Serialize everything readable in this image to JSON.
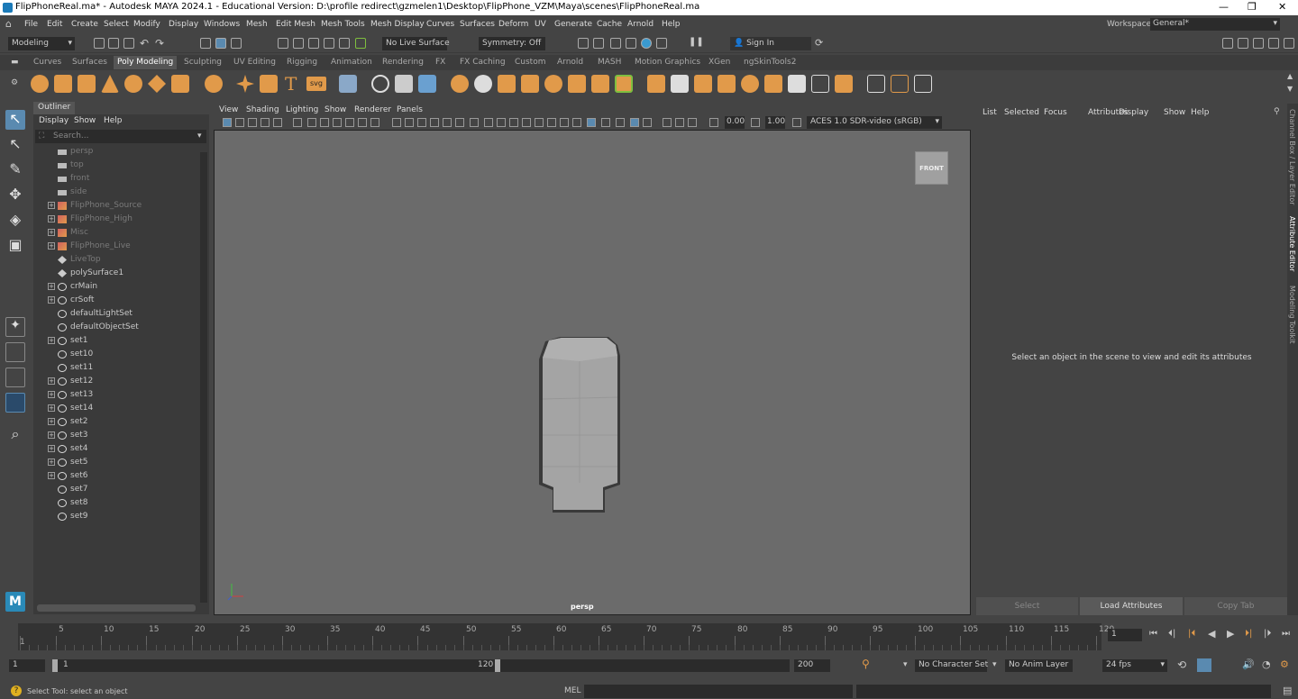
{
  "window": {
    "title": "FlipPhoneReal.ma* - Autodesk MAYA 2024.1 - Educational Version: D:\\profile redirect\\gzmelen1\\Desktop\\FlipPhone_VZM\\Maya\\scenes\\FlipPhoneReal.ma"
  },
  "menu": {
    "items": [
      "File",
      "Edit",
      "Create",
      "Select",
      "Modify",
      "Display",
      "Windows",
      "Mesh",
      "Edit Mesh",
      "Mesh Tools",
      "Mesh Display",
      "Curves",
      "Surfaces",
      "Deform",
      "UV",
      "Generate",
      "Cache",
      "Arnold",
      "Help"
    ],
    "workspace_label": "Workspace:",
    "workspace_value": "General*"
  },
  "status_line": {
    "mode": "Modeling",
    "live_surface": "No Live Surface",
    "symmetry": "Symmetry: Off",
    "sign_in": "Sign In"
  },
  "shelf": {
    "tabs": [
      "Curves",
      "Surfaces",
      "Poly Modeling",
      "Sculpting",
      "UV Editing",
      "Rigging",
      "Animation",
      "Rendering",
      "FX",
      "FX Caching",
      "Custom",
      "Arnold",
      "MASH",
      "Motion Graphics",
      "XGen",
      "ngSkinTools2"
    ],
    "active": "Poly Modeling",
    "svg_label": "svg",
    "text_label": "T"
  },
  "outliner": {
    "tab": "Outliner",
    "menus": [
      "Display",
      "Show",
      "Help"
    ],
    "search_placeholder": "Search...",
    "rows": [
      {
        "label": "persp",
        "dim": true,
        "exp": false,
        "icon": "camera-icon"
      },
      {
        "label": "top",
        "dim": true,
        "exp": false,
        "icon": "camera-icon"
      },
      {
        "label": "front",
        "dim": true,
        "exp": false,
        "icon": "camera-icon"
      },
      {
        "label": "side",
        "dim": true,
        "exp": false,
        "icon": "camera-icon"
      },
      {
        "label": "FlipPhone_Source",
        "dim": true,
        "exp": true,
        "icon": "group-icon"
      },
      {
        "label": "FlipPhone_High",
        "dim": true,
        "exp": true,
        "icon": "group-icon"
      },
      {
        "label": "Misc",
        "dim": true,
        "exp": true,
        "icon": "group-icon"
      },
      {
        "label": "FlipPhone_Live",
        "dim": true,
        "exp": true,
        "icon": "group-icon"
      },
      {
        "label": "LiveTop",
        "dim": true,
        "exp": false,
        "icon": "mesh-icon"
      },
      {
        "label": "polySurface1",
        "dim": false,
        "exp": false,
        "icon": "mesh-icon"
      },
      {
        "label": "crMain",
        "dim": false,
        "exp": true,
        "icon": "set-icon"
      },
      {
        "label": "crSoft",
        "dim": false,
        "exp": true,
        "icon": "set-icon"
      },
      {
        "label": "defaultLightSet",
        "dim": false,
        "exp": false,
        "icon": "set-icon"
      },
      {
        "label": "defaultObjectSet",
        "dim": false,
        "exp": false,
        "icon": "set-icon"
      },
      {
        "label": "set1",
        "dim": false,
        "exp": true,
        "icon": "set-icon"
      },
      {
        "label": "set10",
        "dim": false,
        "exp": false,
        "icon": "set-icon"
      },
      {
        "label": "set11",
        "dim": false,
        "exp": false,
        "icon": "set-icon"
      },
      {
        "label": "set12",
        "dim": false,
        "exp": true,
        "icon": "set-icon"
      },
      {
        "label": "set13",
        "dim": false,
        "exp": true,
        "icon": "set-icon"
      },
      {
        "label": "set14",
        "dim": false,
        "exp": true,
        "icon": "set-icon"
      },
      {
        "label": "set2",
        "dim": false,
        "exp": true,
        "icon": "set-icon"
      },
      {
        "label": "set3",
        "dim": false,
        "exp": true,
        "icon": "set-icon"
      },
      {
        "label": "set4",
        "dim": false,
        "exp": true,
        "icon": "set-icon"
      },
      {
        "label": "set5",
        "dim": false,
        "exp": true,
        "icon": "set-icon"
      },
      {
        "label": "set6",
        "dim": false,
        "exp": true,
        "icon": "set-icon"
      },
      {
        "label": "set7",
        "dim": false,
        "exp": false,
        "icon": "set-icon"
      },
      {
        "label": "set8",
        "dim": false,
        "exp": false,
        "icon": "set-icon"
      },
      {
        "label": "set9",
        "dim": false,
        "exp": false,
        "icon": "set-icon"
      }
    ]
  },
  "viewport": {
    "menus": [
      "View",
      "Shading",
      "Lighting",
      "Show",
      "Renderer",
      "Panels"
    ],
    "exposure": "0.00",
    "gamma": "1.00",
    "color_space": "ACES 1.0 SDR-video (sRGB)",
    "view_cube": "FRONT",
    "camera": "persp"
  },
  "attribute_editor": {
    "menus": [
      "List",
      "Selected",
      "Focus",
      "Attributes",
      "Display",
      "Show",
      "Help"
    ],
    "empty_message": "Select an object in the scene to view and edit its attributes",
    "buttons": {
      "select": "Select",
      "load": "Load Attributes",
      "copy": "Copy Tab"
    },
    "side_tabs": [
      "Channel Box / Layer Editor",
      "Attribute Editor",
      "Modeling Toolkit"
    ]
  },
  "timeline": {
    "ticks": [
      "1",
      "5",
      "10",
      "15",
      "20",
      "25",
      "30",
      "35",
      "40",
      "45",
      "50",
      "55",
      "60",
      "65",
      "70",
      "75",
      "80",
      "85",
      "90",
      "95",
      "100",
      "105",
      "110",
      "115",
      "120"
    ],
    "current_frame": "1"
  },
  "range": {
    "start": "1",
    "inner_start": "1",
    "inner_end": "120",
    "end": "200",
    "character_set": "No Character Set",
    "anim_layer": "No Anim Layer",
    "fps": "24 fps"
  },
  "command_line": {
    "status": "Select Tool: select an object",
    "lang": "MEL"
  },
  "logo": "M"
}
